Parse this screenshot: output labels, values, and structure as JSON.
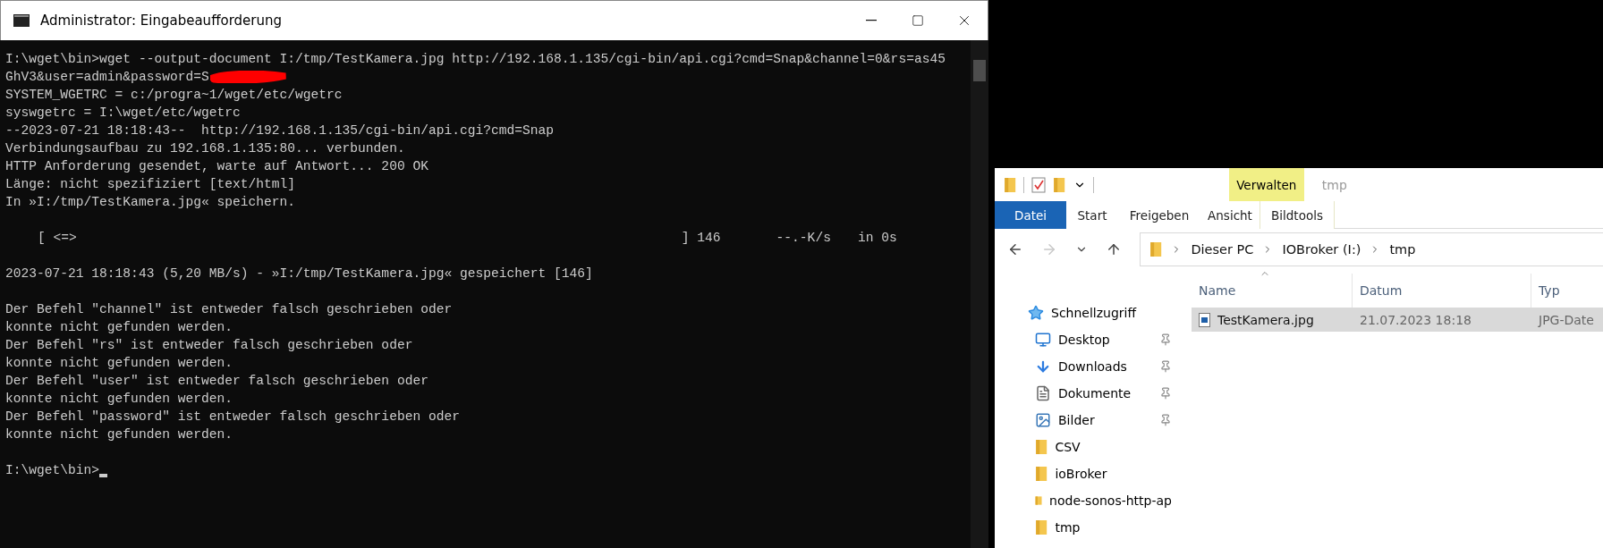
{
  "terminal": {
    "title": "Administrator: Eingabeaufforderung",
    "blocks": [
      {
        "kind": "text",
        "lines": [
          {
            "text": "I:\\wget\\bin>wget --output-document I:/tmp/TestKamera.jpg http://192.168.1.135/cgi-bin/api.cgi?cmd=Snap&channel=0&rs=as45",
            "redacted": false
          },
          {
            "text": "GhV3&user=admin&password=S",
            "redacted": true
          },
          {
            "text": "SYSTEM_WGETRC = c:/progra~1/wget/etc/wgetrc",
            "redacted": false
          },
          {
            "text": "syswgetrc = I:\\wget/etc/wgetrc",
            "redacted": false
          },
          {
            "text": "--2023-07-21 18:18:43--  http://192.168.1.135/cgi-bin/api.cgi?cmd=Snap",
            "redacted": false
          },
          {
            "text": "Verbindungsaufbau zu 192.168.1.135:80... verbunden.",
            "redacted": false
          },
          {
            "text": "HTTP Anforderung gesendet, warte auf Antwort... 200 OK",
            "redacted": false
          },
          {
            "text": "Länge: nicht spezifiziert [text/html]",
            "redacted": false
          },
          {
            "text": "In »I:/tmp/TestKamera.jpg« speichern.",
            "redacted": false
          }
        ]
      },
      {
        "kind": "progress",
        "bar": "[ <=>",
        "received": "] 146",
        "speed": "--.-K/s",
        "time": "in 0s"
      },
      {
        "kind": "text",
        "lines": [
          {
            "text": "2023-07-21 18:18:43 (5,20 MB/s) - »I:/tmp/TestKamera.jpg« gespeichert [146]",
            "redacted": false
          }
        ]
      },
      {
        "kind": "text",
        "lines": [
          {
            "text": "Der Befehl \"channel\" ist entweder falsch geschrieben oder",
            "redacted": false
          },
          {
            "text": "konnte nicht gefunden werden.",
            "redacted": false
          },
          {
            "text": "Der Befehl \"rs\" ist entweder falsch geschrieben oder",
            "redacted": false
          },
          {
            "text": "konnte nicht gefunden werden.",
            "redacted": false
          },
          {
            "text": "Der Befehl \"user\" ist entweder falsch geschrieben oder",
            "redacted": false
          },
          {
            "text": "konnte nicht gefunden werden.",
            "redacted": false
          },
          {
            "text": "Der Befehl \"password\" ist entweder falsch geschrieben oder",
            "redacted": false
          },
          {
            "text": "konnte nicht gefunden werden.",
            "redacted": false
          }
        ]
      },
      {
        "kind": "prompt",
        "text": "I:\\wget\\bin>"
      }
    ]
  },
  "explorer": {
    "context_tab": "Verwalten",
    "window_title": "tmp",
    "ribbon_tabs": [
      {
        "label": "Datei",
        "kind": "file"
      },
      {
        "label": "Start",
        "kind": "tab"
      },
      {
        "label": "Freigeben",
        "kind": "tab"
      },
      {
        "label": "Ansicht",
        "kind": "tab"
      },
      {
        "label": "Bildtools",
        "kind": "context"
      }
    ],
    "breadcrumb": [
      "Dieser PC",
      "IOBroker (I:)",
      "tmp"
    ],
    "sidebar": [
      {
        "label": "Schnellzugriff",
        "kind": "quick",
        "pinned": false,
        "children": [
          {
            "label": "Desktop",
            "kind": "desktop",
            "pinned": true
          },
          {
            "label": "Downloads",
            "kind": "downloads",
            "pinned": true
          },
          {
            "label": "Dokumente",
            "kind": "documents",
            "pinned": true
          },
          {
            "label": "Bilder",
            "kind": "pictures",
            "pinned": true
          },
          {
            "label": "CSV",
            "kind": "folder",
            "pinned": false
          },
          {
            "label": "ioBroker",
            "kind": "folder",
            "pinned": false
          },
          {
            "label": "node-sonos-http-ap",
            "kind": "folder",
            "pinned": false
          },
          {
            "label": "tmp",
            "kind": "folder",
            "pinned": false
          }
        ]
      }
    ],
    "columns": [
      "Name",
      "Datum",
      "Typ"
    ],
    "files": [
      {
        "name": "TestKamera.jpg",
        "date": "21.07.2023 18:18",
        "type": "JPG-Date",
        "selected": true
      }
    ]
  }
}
